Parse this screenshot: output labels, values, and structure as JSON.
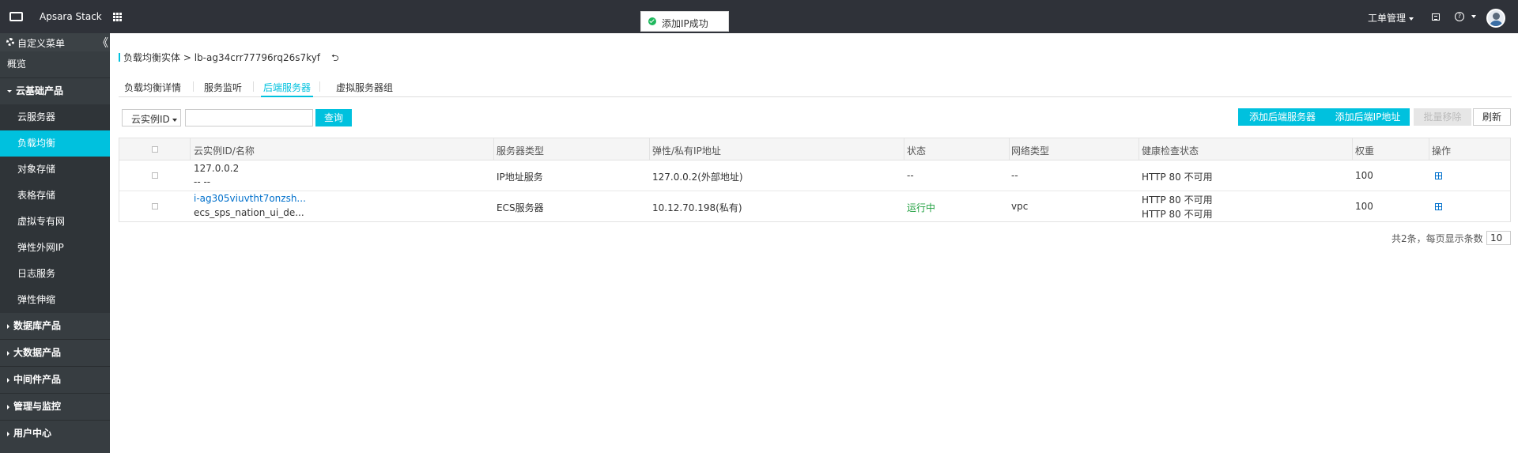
{
  "topbar": {
    "brand": "Apsara Stack",
    "toast": "添加IP成功",
    "ticket": "工单管理",
    "help": "?"
  },
  "sidebar": {
    "header": "自定义菜单",
    "collapse": "《",
    "overview": "概览",
    "category_open": "云基础产品",
    "items": [
      "云服务器",
      "负载均衡",
      "对象存储",
      "表格存储",
      "虚拟专有网",
      "弹性外网IP",
      "日志服务",
      "弹性伸缩"
    ],
    "categories": [
      "数据库产品",
      "大数据产品",
      "中间件产品",
      "管理与监控",
      "用户中心"
    ]
  },
  "breadcrumb": {
    "parent": "负载均衡实体",
    "separator": ">",
    "current": "lb-ag34crr77796rq26s7kyf",
    "back": "⮌"
  },
  "tabs": [
    "负载均衡详情",
    "服务监听",
    "后端服务器",
    "虚拟服务器组"
  ],
  "toolbar": {
    "filter": "云实例ID",
    "search_placeholder": "",
    "query": "查询",
    "add_backend": "添加后端服务器",
    "add_ip": "添加后端IP地址",
    "batch_remove": "批量移除",
    "refresh": "刷新"
  },
  "table": {
    "headers": [
      "云实例ID/名称",
      "服务器类型",
      "弹性/私有IP地址",
      "状态",
      "网络类型",
      "健康检查状态",
      "权重",
      "操作"
    ],
    "rows": [
      {
        "id": "127.0.0.2",
        "name": "-- --",
        "type": "IP地址服务",
        "ip": "127.0.0.2(外部地址)",
        "status": "--",
        "network": "--",
        "health1": "HTTP 80 不可用",
        "health2": "",
        "weight": "100"
      },
      {
        "id": "i-ag305viuvtht7onzsh...",
        "name": "ecs_sps_nation_ui_de...",
        "type": "ECS服务器",
        "ip": "10.12.70.198(私有)",
        "status": "运行中",
        "network": "vpc",
        "health1": "HTTP 80 不可用",
        "health2": "HTTP 80 不可用",
        "weight": "100"
      }
    ]
  },
  "pager": {
    "summary": "共2条，每页显示条数",
    "page_size": "10"
  },
  "colors": {
    "accent": "#00c1de",
    "topbar": "#2f3239",
    "sidebar": "#373d41",
    "running": "#1e9f3e",
    "link": "#0070cc"
  }
}
